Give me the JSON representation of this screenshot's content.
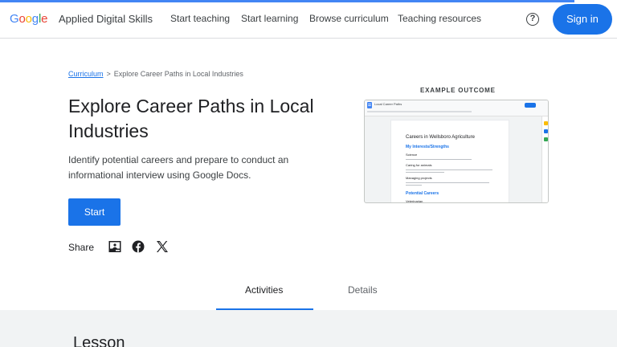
{
  "header": {
    "logo_letters": [
      {
        "ch": "G",
        "color": "#4285f4"
      },
      {
        "ch": "o",
        "color": "#ea4335"
      },
      {
        "ch": "o",
        "color": "#fbbc05"
      },
      {
        "ch": "g",
        "color": "#4285f4"
      },
      {
        "ch": "l",
        "color": "#34a853"
      },
      {
        "ch": "e",
        "color": "#ea4335"
      }
    ],
    "brand": "Applied Digital Skills",
    "nav": [
      "Start teaching",
      "Start learning",
      "Browse curriculum",
      "Teaching resources"
    ],
    "help_icon": "?",
    "sign_in": "Sign in"
  },
  "breadcrumb": {
    "root": "Curriculum",
    "separator": ">",
    "current": "Explore Career Paths in Local Industries"
  },
  "hero": {
    "title": "Explore Career Paths in Local Industries",
    "description": "Identify potential careers and prepare to conduct an informational interview using Google Docs.",
    "start_button": "Start",
    "share_label": "Share",
    "share_icons": [
      "classroom-icon",
      "facebook-icon",
      "x-icon"
    ]
  },
  "example": {
    "label": "EXAMPLE OUTCOME",
    "doc_file_title": "Local Career Paths",
    "doc_heading": "Careers in Wellsboro Agriculture",
    "doc_section_1": "My Interests/Strengths",
    "doc_items": [
      "Science",
      "Caring for animals",
      "Managing projects"
    ],
    "doc_section_2": "Potential Careers",
    "doc_last_item": "Veterinarian"
  },
  "tabs": {
    "items": [
      "Activities",
      "Details"
    ],
    "active": "Activities"
  },
  "lesson": {
    "heading": "Lesson"
  },
  "colors": {
    "primary": "#1a73e8",
    "accent_line": "#4285f4",
    "panel_bg": "#f1f3f4"
  }
}
